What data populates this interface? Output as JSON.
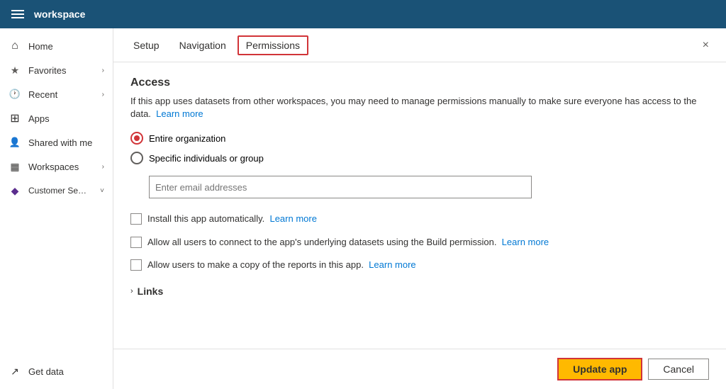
{
  "topbar": {
    "title": "workspace"
  },
  "sidebar": {
    "items": [
      {
        "id": "home",
        "label": "Home",
        "icon": "home",
        "hasChevron": false
      },
      {
        "id": "favorites",
        "label": "Favorites",
        "icon": "favorites",
        "hasChevron": true
      },
      {
        "id": "recent",
        "label": "Recent",
        "icon": "recent",
        "hasChevron": true
      },
      {
        "id": "apps",
        "label": "Apps",
        "icon": "apps",
        "hasChevron": false
      },
      {
        "id": "shared",
        "label": "Shared with me",
        "icon": "shared",
        "hasChevron": false
      },
      {
        "id": "workspaces",
        "label": "Workspaces",
        "icon": "workspaces",
        "hasChevron": true
      },
      {
        "id": "customer",
        "label": "Customer Service A...",
        "icon": "customer",
        "hasChevron": true
      }
    ],
    "bottom_items": [
      {
        "id": "getdata",
        "label": "Get data",
        "icon": "getdata"
      }
    ]
  },
  "tabs": {
    "items": [
      {
        "id": "setup",
        "label": "Setup",
        "active": false
      },
      {
        "id": "navigation",
        "label": "Navigation",
        "active": false
      },
      {
        "id": "permissions",
        "label": "Permissions",
        "active": true
      }
    ],
    "close_label": "×"
  },
  "content": {
    "access_title": "Access",
    "description": "If this app uses datasets from other workspaces, you may need to manage permissions manually to make sure everyone has access to the data.",
    "learn_more_1": "Learn more",
    "radio_options": [
      {
        "id": "entire-org",
        "label": "Entire organization",
        "selected": true
      },
      {
        "id": "specific",
        "label": "Specific individuals or group",
        "selected": false
      }
    ],
    "email_placeholder": "Enter email addresses",
    "checkboxes": [
      {
        "id": "install-auto",
        "label": "Install this app automatically.",
        "learn_more": "Learn more",
        "checked": false
      },
      {
        "id": "allow-build",
        "label": "Allow all users to connect to the app's underlying datasets using the Build permission.",
        "learn_more": "Learn more",
        "checked": false
      },
      {
        "id": "allow-copy",
        "label": "Allow users to make a copy of the reports in this app.",
        "learn_more": "Learn more",
        "checked": false
      }
    ],
    "links_label": "Links"
  },
  "footer": {
    "update_label": "Update app",
    "cancel_label": "Cancel"
  }
}
